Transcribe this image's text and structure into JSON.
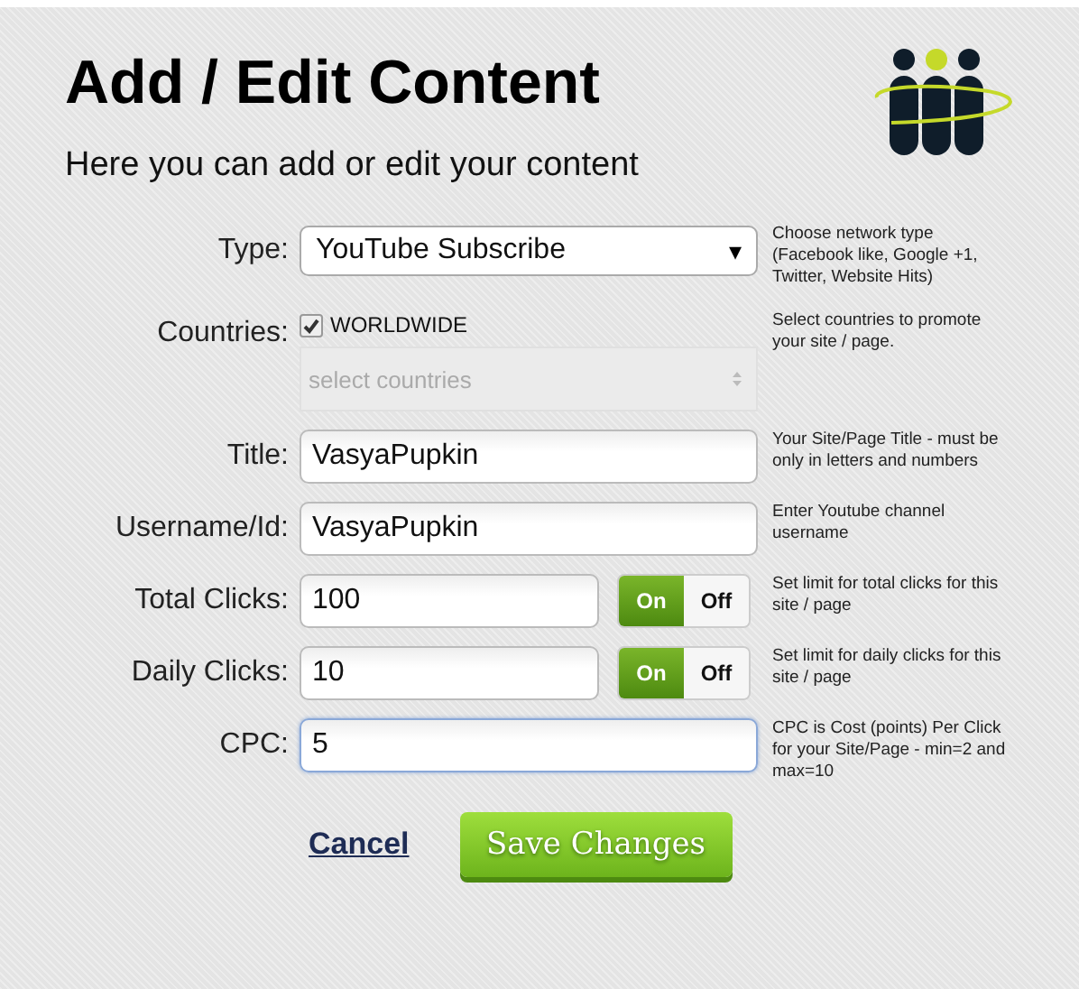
{
  "header": {
    "title": "Add / Edit Content",
    "subtitle": "Here you can add or edit your content"
  },
  "rows": [
    {
      "kind": "select",
      "label": "Type:",
      "value": "YouTube Subscribe",
      "caret": "▾",
      "hint": "Choose network type (Facebook like, Google +1, Twitter, Website Hits)"
    },
    {
      "kind": "countries",
      "label": "Countries:",
      "checkbox_label": "WORLDWIDE",
      "checked": true,
      "placeholder": "select countries",
      "disabled": true,
      "hint": "Select countries to promote your site / page."
    },
    {
      "kind": "text",
      "label": "Title:",
      "value": "VasyaPupkin",
      "focused": false,
      "hint": "Your Site/Page Title - must be only in letters and numbers"
    },
    {
      "kind": "text",
      "label": "Username/Id:",
      "value": "VasyaPupkin",
      "focused": false,
      "hint": "Enter Youtube channel username"
    },
    {
      "kind": "clicks",
      "label": "Total Clicks:",
      "value": "100",
      "on_label": "On",
      "off_label": "Off",
      "on": true,
      "hint": "Set limit for total clicks for this site / page"
    },
    {
      "kind": "clicks",
      "label": "Daily Clicks:",
      "value": "10",
      "on_label": "On",
      "off_label": "Off",
      "on": true,
      "hint": "Set limit for daily clicks for this site / page"
    },
    {
      "kind": "text",
      "label": "CPC:",
      "value": "5",
      "focused": true,
      "hint": "CPC is Cost (points) Per Click for your Site/Page - min=2 and max=10"
    }
  ],
  "actions": {
    "cancel": "Cancel",
    "save": "Save Changes"
  }
}
